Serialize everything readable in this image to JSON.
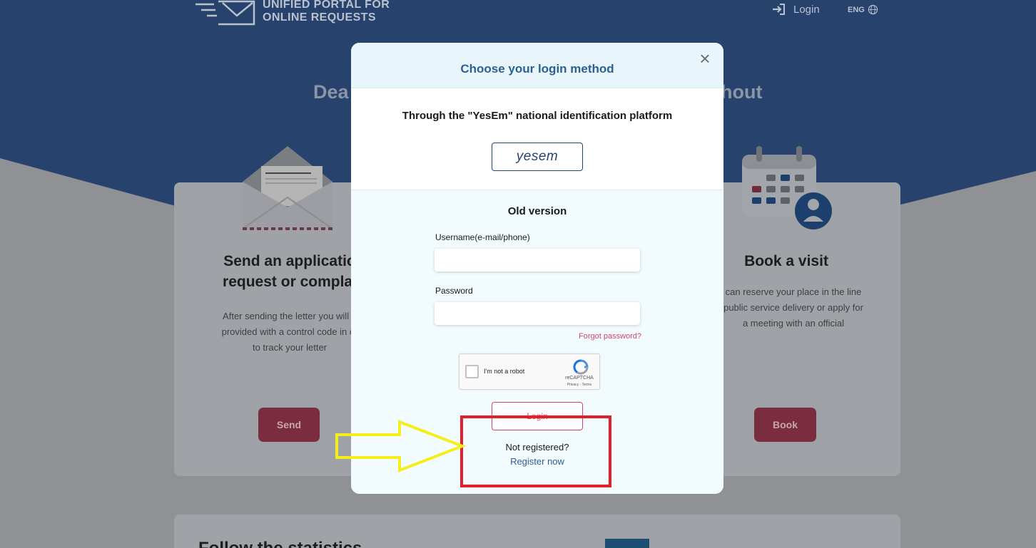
{
  "header": {
    "logo_line1": "UNIFIED PORTAL FOR",
    "logo_line2": "ONLINE REQUESTS",
    "login_label": "Login",
    "lang_label": "ENG"
  },
  "hero": {
    "title_left": "Dea",
    "title_right": "hout"
  },
  "cards": {
    "send": {
      "title_line1": "Send an applicatio",
      "title_line2": "request or complai",
      "text_line1": "After sending the letter you will b",
      "text_line2": "provided with a control code in or",
      "text_line3": "to track your letter",
      "button_label": "Send"
    },
    "book": {
      "title": "Book a visit",
      "text_line1": "can reserve your place in the line",
      "text_line2": "public service delivery or apply for",
      "text_line3": "a meeting with an official",
      "button_label": "Book"
    },
    "stats_title": "Follow the statistics"
  },
  "modal": {
    "title": "Choose your login method",
    "close_glyph": "×",
    "yesem_title": "Through the \"YesEm\" national identification platform",
    "yesem_logo_text": "yesem",
    "old_version_title": "Old version",
    "username_label": "Username(e-mail/phone)",
    "username_value": "",
    "password_label": "Password",
    "password_value": "",
    "forgot_label": "Forgot password?",
    "recaptcha": {
      "label": "I'm not a robot",
      "brand": "reCAPTCHA",
      "links": "Privacy - Terms"
    },
    "login_button_label": "Login",
    "not_registered": "Not registered?",
    "register_label": "Register now"
  },
  "colors": {
    "hero_blue": "#26426d",
    "accent_pink": "#d6436a",
    "link_blue": "#2e5f93",
    "annotation_red": "#e0202a",
    "annotation_yellow": "#f5ee1a"
  },
  "icons": [
    "envelope-logo-icon",
    "login-icon",
    "globe-icon",
    "envelope-illustration",
    "calendar-illustration",
    "recaptcha-icon",
    "close-icon"
  ]
}
